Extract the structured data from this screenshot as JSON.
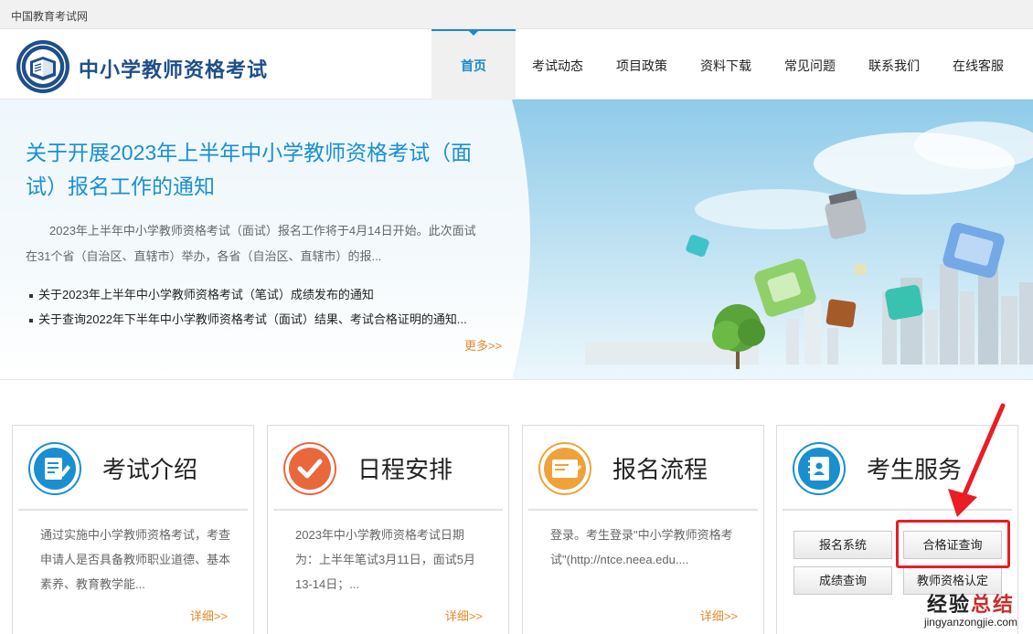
{
  "topbar": {
    "site_name": "中国教育考试网"
  },
  "header": {
    "title": "中小学教师资格考试",
    "nav": [
      "首页",
      "考试动态",
      "项目政策",
      "资料下载",
      "常见问题",
      "联系我们",
      "在线客服"
    ]
  },
  "banner": {
    "headline": "关于开展2023年上半年中小学教师资格考试（面试）报名工作的通知",
    "summary": "2023年上半年中小学教师资格考试（面试）报名工作将于4月14日开始。此次面试在31个省（自治区、直辖市）举办，各省（自治区、直辖市）的报...",
    "news": [
      "关于2023年上半年中小学教师资格考试（笔试）成绩发布的通知",
      "关于查询2022年下半年中小学教师资格考试（面试）结果、考试合格证明的通知..."
    ],
    "more_label": "更多>>"
  },
  "cards": [
    {
      "title": "考试介绍",
      "text": "通过实施中小学教师资格考试，考查申请人是否具备教师职业道德、基本素养、教育教学能...",
      "detail": "详细>>",
      "icon": "document-edit-icon"
    },
    {
      "title": "日程安排",
      "text": "2023年中小学教师资格考试日期为：上半年笔试3月11日，面试5月13-14日；...",
      "detail": "详细>>",
      "icon": "checkmark-icon"
    },
    {
      "title": "报名流程",
      "text": "登录。考生登录\"中小学教师资格考试\"(http://ntce.neea.edu....",
      "detail": "详细>>",
      "icon": "form-pencil-icon"
    },
    {
      "title": "考生服务",
      "icon": "contact-book-icon",
      "buttons": [
        "报名系统",
        "合格证查询",
        "成绩查询",
        "教师资格认定"
      ]
    }
  ],
  "watermark": {
    "main_black": "经验",
    "main_red": "总结",
    "sub": "jingyanzongjie.com"
  },
  "colors": {
    "brand_blue": "#1f4f8a",
    "link_blue": "#1a8fd0",
    "accent_orange": "#e7892b",
    "highlight_red": "#ea1c24"
  }
}
